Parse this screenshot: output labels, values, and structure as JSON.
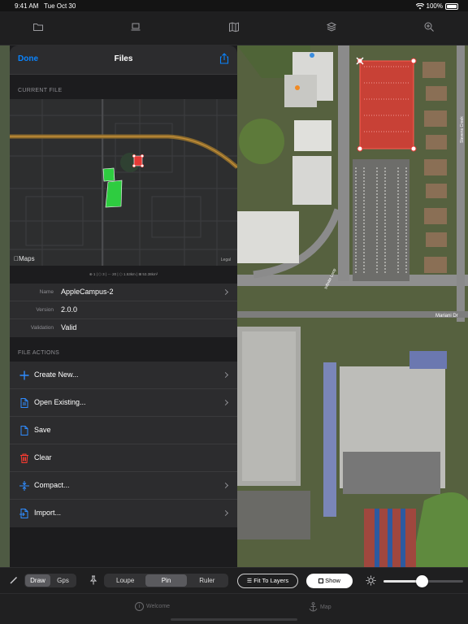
{
  "status_bar": {
    "time": "9:41 AM",
    "date": "Tue Oct 30",
    "battery": "100%"
  },
  "top_toolbar": {
    "icons": [
      "folder-icon",
      "laptop-icon",
      "map-icon",
      "layers-icon",
      "zoom-in-icon"
    ]
  },
  "files_panel": {
    "done": "Done",
    "title": "Files",
    "current_file_header": "CURRENT FILE",
    "preview": {
      "maps_label": "Maps",
      "legal_label": "Legal",
      "stats": "⊕ 1 | ⬡ 3 | ⋯ 20 | ⬡ 1.53km | ⊞ 53.38km²"
    },
    "info": {
      "name_label": "Name",
      "name_value": "AppleCampus-2",
      "version_label": "Version",
      "version_value": "2.0.0",
      "validation_label": "Validation",
      "validation_value": "Valid"
    },
    "file_actions_header": "FILE ACTIONS",
    "actions": [
      {
        "label": "Create New...",
        "icon": "plus-icon",
        "color": "#2f8cff"
      },
      {
        "label": "Open Existing...",
        "icon": "document-icon",
        "color": "#2f8cff"
      },
      {
        "label": "Save",
        "icon": "document-icon",
        "color": "#2f8cff"
      },
      {
        "label": "Clear",
        "icon": "trash-icon",
        "color": "#ff3b30"
      },
      {
        "label": "Compact...",
        "icon": "compress-icon",
        "color": "#2f8cff"
      },
      {
        "label": "Import...",
        "icon": "import-icon",
        "color": "#2f8cff"
      }
    ]
  },
  "map_labels": {
    "road1": "Stevens Creek",
    "road2": "Mariani Dr",
    "road3": "Infinite Loop"
  },
  "bottom_toolbar": {
    "mode_left": [
      "Draw",
      "Gps"
    ],
    "mode_left_active": "Draw",
    "mode_center": [
      "Loupe",
      "Pin",
      "Ruler"
    ],
    "mode_center_active": "Pin",
    "fit_to_layers": "Fit To Layers",
    "show": "Show",
    "brightness_level": 0.48
  },
  "tab_bar": {
    "welcome": "Welcome",
    "map": "Map"
  },
  "colors": {
    "accent": "#0a84ff",
    "danger": "#ff3b30",
    "selection_fill": "#e53935"
  }
}
